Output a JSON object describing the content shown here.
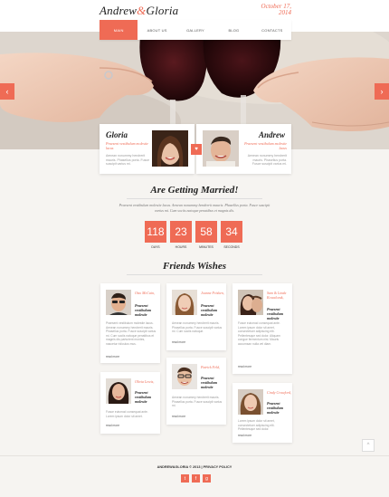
{
  "header": {
    "logo_first": "Andrew",
    "logo_amp": "&",
    "logo_second": "Gloria",
    "date_line1": "October 17,",
    "date_line2": "2014"
  },
  "nav": [
    {
      "label": "Main",
      "active": true
    },
    {
      "label": "About us",
      "active": false
    },
    {
      "label": "Gallery",
      "active": false
    },
    {
      "label": "Blog",
      "active": false
    },
    {
      "label": "Contacts",
      "active": false
    }
  ],
  "hero": {
    "prev_icon": "chevron-left-icon",
    "next_icon": "chevron-right-icon",
    "prev_glyph": "‹",
    "next_glyph": "›"
  },
  "couple": {
    "bride": {
      "name": "Gloria",
      "subtitle": "Praesent vestibulum molestie lacus",
      "text": "Aenean nonummy hendrerit mauris. Phasellus porta. Fusce suscipit varius mi."
    },
    "groom": {
      "name": "Andrew",
      "subtitle": "Praesent vestibulum molestie lacus",
      "text": "Aenean nonummy hendrerit mauris. Phasellus porta. Fusce suscipit varius mi."
    },
    "heart_glyph": "♥"
  },
  "married": {
    "title": "Are Getting Married!",
    "text": "Praesent vestibulum molestie lacus. Aenean nonummy hendrerit mauris. Phasellus porta. Fusce suscipit varius mi. Cum sociis natoque penatibus et magnis dis."
  },
  "countdown": [
    {
      "value": "118",
      "label": "Days"
    },
    {
      "value": "23",
      "label": "Hours"
    },
    {
      "value": "58",
      "label": "Minutes"
    },
    {
      "value": "34",
      "label": "Seconds"
    }
  ],
  "wishes": {
    "title": "Friends Wishes",
    "items": [
      {
        "name": "Otto McCain,",
        "subtitle": "Praesent vestibulum molestie",
        "text": "Praesent vestibulum molestie lacus. Aenean nonummy hendrerit mauris. Phasellus porta. Fusce suscipit varius mi. Cum sociis natoque penatibus et magnis dis parturient montes, nascetur ridiculus mus.",
        "more": "read more"
      },
      {
        "name": "Joanne Frisken,",
        "subtitle": "Praesent vestibulum molestie",
        "text": "Aenean nonummy hendrerit mauris. Phasellus porta. Fusce suscipit varius mi. Cum sociis natoque.",
        "more": "read more"
      },
      {
        "name": "Sam & Linda Kowalczuk,",
        "subtitle": "Praesent vestibulum molestie",
        "text": "Fusce euismod consequat ante. Lorem ipsum dolor sit amet, consectetuer adipiscing elit. Pellentesque sed dolor. Aliquam congue fermentum nisl. Mauris accumsan nulla vel diam.",
        "more": "read more"
      },
      {
        "name": "Olivia Lewis,",
        "subtitle": "Praesent vestibulum molestie",
        "text": "Fusce euismod consequat ante. Lorem ipsum dolor sit amet.",
        "more": "read more"
      },
      {
        "name": "Patrick Feld,",
        "subtitle": "Praesent vestibulum molestie",
        "text": "Aenean nonummy hendrerit mauris. Phasellus porta. Fusce suscipit varius mi.",
        "more": "read more"
      },
      {
        "name": "Cindy Crawford,",
        "subtitle": "Praesent vestibulum molestie",
        "text": "Lorem ipsum dolor sit amet, consectetuer adipiscing elit. Pellentesque sed dolor.",
        "more": "read more"
      }
    ]
  },
  "back_to_top_glyph": "^",
  "footer": {
    "copyright": "ANDREW&GLORIA © 2013 | PRIVACY POLICY",
    "social": [
      {
        "icon": "twitter-icon",
        "glyph": "t"
      },
      {
        "icon": "facebook-icon",
        "glyph": "f"
      },
      {
        "icon": "google-plus-icon",
        "glyph": "g"
      }
    ]
  },
  "colors": {
    "accent": "#ef6b55",
    "background": "#f6f4f1"
  }
}
